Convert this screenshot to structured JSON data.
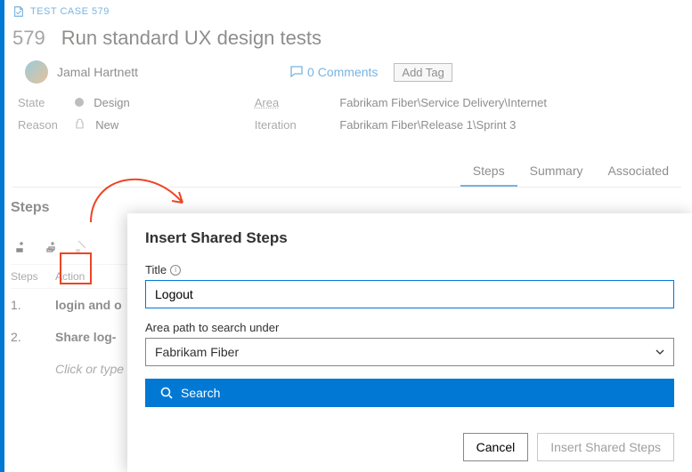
{
  "breadcrumb": {
    "label": "TEST CASE 579"
  },
  "title": {
    "id": "579",
    "text": "Run standard UX design tests"
  },
  "assignee": {
    "name": "Jamal Hartnett"
  },
  "comments": {
    "label": "0 Comments"
  },
  "tags": {
    "add_label": "Add Tag"
  },
  "meta": {
    "state_label": "State",
    "state_value": "Design",
    "reason_label": "Reason",
    "reason_value": "New",
    "area_label": "Area",
    "area_value": "Fabrikam Fiber\\Service Delivery\\Internet",
    "iteration_label": "Iteration",
    "iteration_value": "Fabrikam Fiber\\Release 1\\Sprint 3"
  },
  "tabs": {
    "steps": "Steps",
    "summary": "Summary",
    "associated": "Associated"
  },
  "steps_panel": {
    "title": "Steps",
    "header_steps": "Steps",
    "header_action": "Action",
    "rows": [
      {
        "num": "1.",
        "action": "login and o"
      },
      {
        "num": "2.",
        "action": "Share log-"
      }
    ],
    "placeholder_row": "Click or type"
  },
  "dialog": {
    "title": "Insert Shared Steps",
    "title_field_label": "Title",
    "title_value": "Logout",
    "area_label": "Area path to search under",
    "area_value": "Fabrikam Fiber",
    "search_label": "Search",
    "cancel_label": "Cancel",
    "confirm_label": "Insert Shared Steps"
  }
}
